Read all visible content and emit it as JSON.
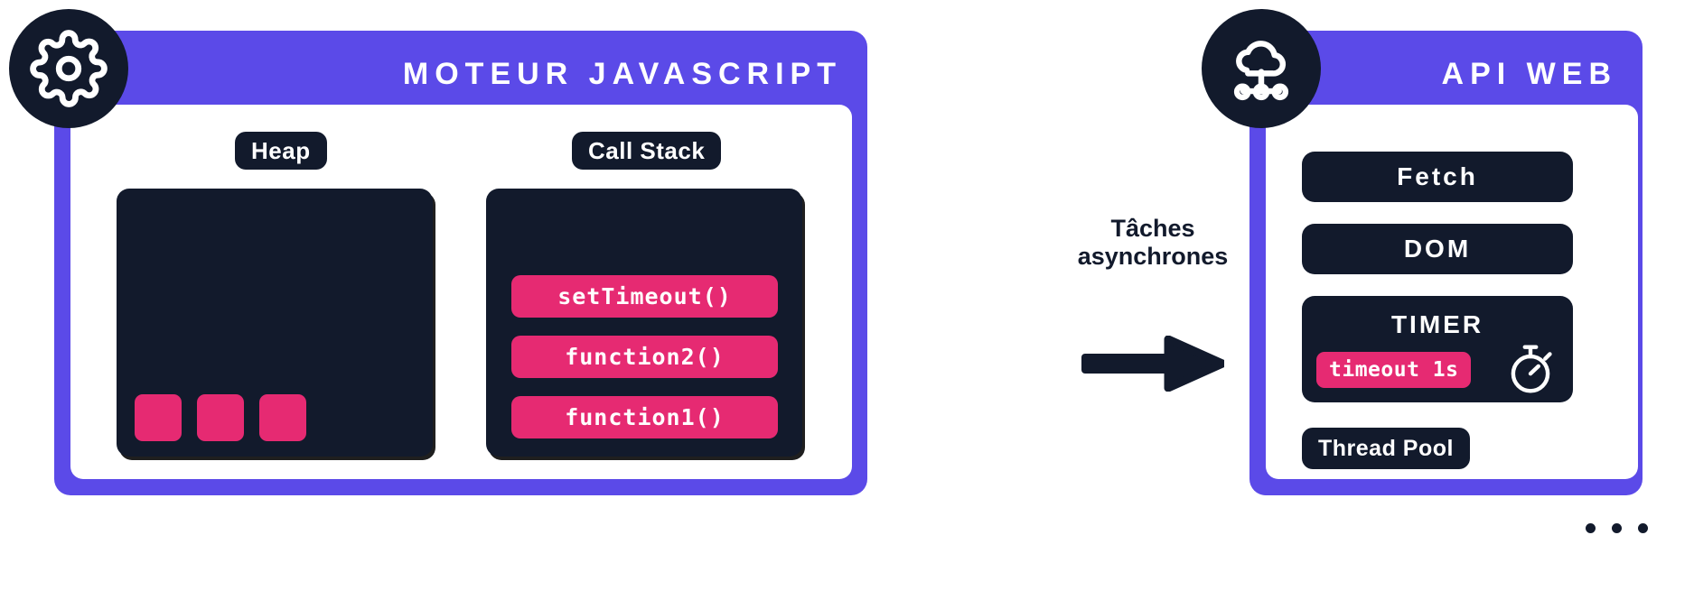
{
  "diagram": {
    "title_left": "MOTEUR JAVASCRIPT",
    "title_right": "API WEB"
  },
  "engine_panel": {
    "title": "MOTEUR JAVASCRIPT",
    "icon": "gear-icon",
    "heap": {
      "label": "Heap",
      "objects": [
        "object",
        "object",
        "object"
      ]
    },
    "call_stack": {
      "label": "Call Stack",
      "frames": [
        {
          "name": "setTimeout()"
        },
        {
          "name": "function2()"
        },
        {
          "name": "function1()"
        }
      ]
    }
  },
  "connector": {
    "label_line1": "Tâches",
    "label_line2": "asynchrones",
    "icon": "arrow-right-icon"
  },
  "web_api_panel": {
    "title": "API WEB",
    "icon": "cloud-network-icon",
    "items": [
      {
        "label": "Fetch"
      },
      {
        "label": "DOM"
      }
    ],
    "timer": {
      "label": "TIMER",
      "badge": "timeout 1s",
      "icon": "stopwatch-icon"
    },
    "thread_pool": {
      "label": "Thread Pool"
    },
    "more_indicator": "ellipsis-icon"
  },
  "colors": {
    "purple": "#5b4ae8",
    "dark": "#121a2c",
    "pink": "#e62a72",
    "white": "#ffffff"
  }
}
